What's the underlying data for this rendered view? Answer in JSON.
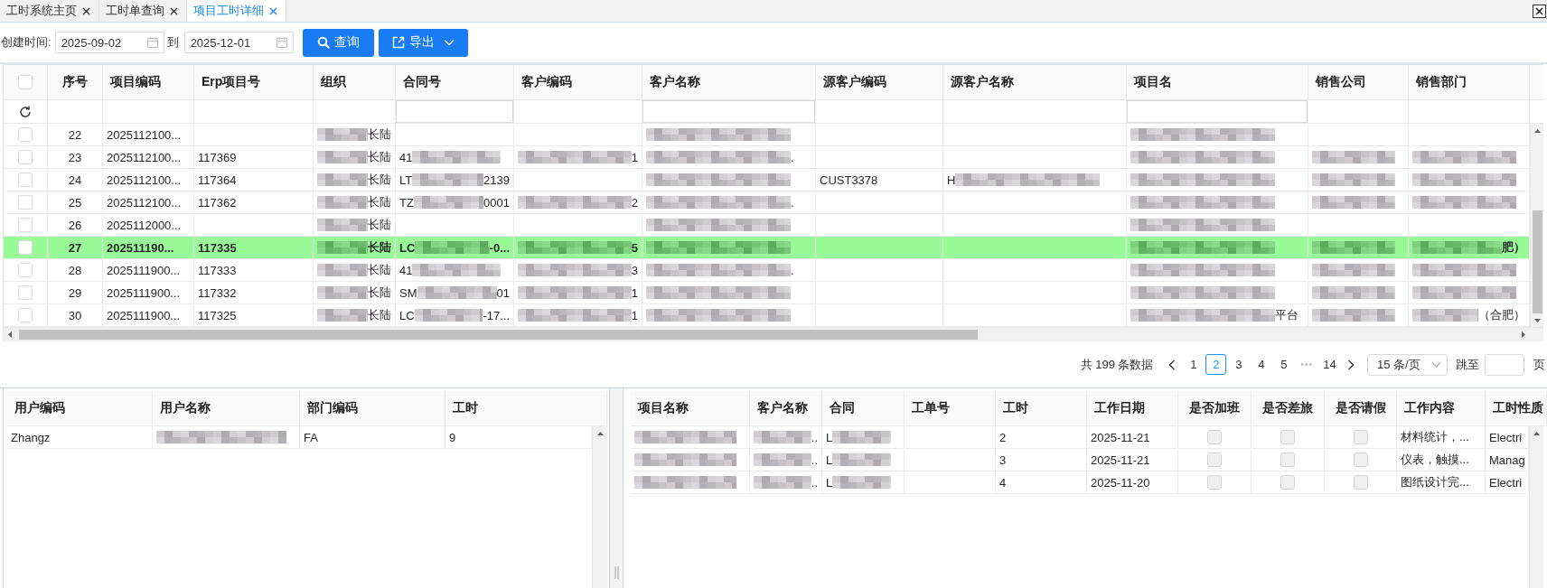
{
  "tabs": [
    {
      "label": "工时系统主页",
      "selected": false
    },
    {
      "label": "工时单查询",
      "selected": false
    },
    {
      "label": "项目工时详细",
      "selected": true
    }
  ],
  "toolbar": {
    "date_label": "创建时间:",
    "start_date": "2025-09-02",
    "range_separator": "到",
    "end_date": "2025-12-01",
    "buttons": [
      {
        "label": "查询",
        "kind": "search"
      },
      {
        "label": "导出",
        "kind": "export"
      }
    ]
  },
  "main_table": {
    "select_all": {
      "checked": false
    },
    "columns": [
      {
        "label": "序号",
        "filter": false
      },
      {
        "label": "项目编码",
        "filter": false
      },
      {
        "label": "Erp项目号",
        "filter": false
      },
      {
        "label": "组织",
        "filter": false
      },
      {
        "label": "合同号",
        "filter": true
      },
      {
        "label": "客户编码",
        "filter": false
      },
      {
        "label": "客户名称",
        "filter": true
      },
      {
        "label": "源客户编码",
        "filter": false
      },
      {
        "label": "源客户名称",
        "filter": false
      },
      {
        "label": "项目名",
        "filter": true
      },
      {
        "label": "销售公司",
        "filter": false
      },
      {
        "label": "销售部门",
        "filter": false
      }
    ],
    "rows": [
      {
        "checked": false,
        "selected": false,
        "cells": [
          "22",
          "2025112100...",
          null,
          {
            "blurred": true,
            "after": "长陆"
          },
          null,
          null,
          {
            "blurred": true
          },
          null,
          null,
          {
            "blurred": true
          },
          null,
          null
        ]
      },
      {
        "checked": false,
        "selected": false,
        "cells": [
          "23",
          "2025112100...",
          "117369",
          {
            "blurred": true,
            "after": "长陆"
          },
          {
            "before": "41",
            "blurred": true
          },
          {
            "blurred": true,
            "after": "1"
          },
          {
            "blurred": true,
            "after": "."
          },
          null,
          null,
          {
            "blurred": true
          },
          {
            "blurred": true
          },
          {
            "blurred": true
          }
        ]
      },
      {
        "checked": false,
        "selected": false,
        "cells": [
          "24",
          "2025112100...",
          "117364",
          {
            "blurred": true,
            "after": "长陆"
          },
          {
            "before": "LT",
            "blurred": true,
            "after": "2139"
          },
          null,
          {
            "blurred": true
          },
          "CUST3378",
          {
            "before": "H",
            "blurred": true
          },
          {
            "blurred": true
          },
          {
            "blurred": true
          },
          {
            "blurred": true
          }
        ]
      },
      {
        "checked": false,
        "selected": false,
        "cells": [
          "25",
          "2025112100...",
          "117362",
          {
            "blurred": true,
            "after": "长陆"
          },
          {
            "before": "TZ",
            "blurred": true,
            "after": "0001"
          },
          {
            "blurred": true,
            "after": "2"
          },
          {
            "blurred": true,
            "after": "."
          },
          null,
          null,
          {
            "blurred": true
          },
          {
            "blurred": true
          },
          {
            "blurred": true
          }
        ]
      },
      {
        "checked": false,
        "selected": false,
        "cells": [
          "26",
          "2025112000...",
          null,
          {
            "blurred": true,
            "after": "长陆"
          },
          null,
          null,
          {
            "blurred": true
          },
          null,
          null,
          {
            "blurred": true
          },
          null,
          null
        ]
      },
      {
        "checked": false,
        "selected": true,
        "cells": [
          "27",
          "202511190...",
          "117335",
          {
            "blurred": true,
            "after": "长陆"
          },
          {
            "before": "LC",
            "blurred": true,
            "after": "-0..."
          },
          {
            "blurred": true,
            "after": "5"
          },
          {
            "blurred": true
          },
          null,
          null,
          {
            "blurred": true
          },
          {
            "blurred": true
          },
          {
            "blurred": true,
            "after": "肥）"
          }
        ]
      },
      {
        "checked": false,
        "selected": false,
        "cells": [
          "28",
          "2025111900...",
          "117333",
          {
            "blurred": true,
            "after": "长陆"
          },
          {
            "before": "41",
            "blurred": true
          },
          {
            "blurred": true,
            "after": "3"
          },
          {
            "blurred": true,
            "after": "."
          },
          null,
          null,
          {
            "blurred": true
          },
          {
            "blurred": true
          },
          {
            "blurred": true
          }
        ]
      },
      {
        "checked": false,
        "selected": false,
        "cells": [
          "29",
          "2025111900...",
          "117332",
          {
            "blurred": true,
            "after": "长陆"
          },
          {
            "before": "SM",
            "blurred": true,
            "after": "01"
          },
          {
            "blurred": true,
            "after": "1"
          },
          {
            "blurred": true
          },
          null,
          null,
          {
            "blurred": true
          },
          {
            "blurred": true
          },
          {
            "blurred": true
          }
        ]
      },
      {
        "checked": false,
        "selected": false,
        "cells": [
          "30",
          "2025111900...",
          "117325",
          {
            "blurred": true,
            "after": "长陆"
          },
          {
            "before": "LC",
            "blurred": true,
            "after": "-17..."
          },
          {
            "blurred": true,
            "after": "1"
          },
          {
            "blurred": true
          },
          null,
          null,
          {
            "blurred": true,
            "after": "平台"
          },
          {
            "blurred": true
          },
          {
            "blurred": true,
            "after": "（合肥）"
          }
        ]
      }
    ]
  },
  "pagination": {
    "total": "共 199 条数据",
    "pages": [
      {
        "kind": "page",
        "label": "1",
        "selected": false
      },
      {
        "kind": "page",
        "label": "2",
        "selected": true
      },
      {
        "kind": "page",
        "label": "3",
        "selected": false
      },
      {
        "kind": "page",
        "label": "4",
        "selected": false
      },
      {
        "kind": "page",
        "label": "5",
        "selected": false
      },
      {
        "kind": "ellipsis",
        "label": "•••",
        "selected": false
      },
      {
        "kind": "page",
        "label": "14",
        "selected": false
      }
    ],
    "page_size": "15 条/页",
    "jump_label": "跳至",
    "page_unit": "页"
  },
  "user_table": {
    "columns": [
      "用户编码",
      "用户名称",
      "部门编码",
      "工时"
    ],
    "rows": [
      {
        "cells": [
          "Zhangz",
          {
            "blurred": true
          },
          "FA",
          "9"
        ]
      }
    ]
  },
  "detail_table": {
    "columns": [
      "项目名称",
      "客户名称",
      "合同",
      "工单号",
      "工时",
      "工作日期",
      "是否加班",
      "是否差旅",
      "是否请假",
      "工作内容",
      "工时性质"
    ],
    "rows": [
      {
        "cells": [
          {
            "blurred": true
          },
          {
            "blurred": true,
            "after": ".."
          },
          {
            "before": "L",
            "blurred": true
          },
          null,
          "2",
          "2025-11-21",
          {
            "checked": false,
            "disabled": true
          },
          {
            "checked": false,
            "disabled": true
          },
          {
            "checked": false,
            "disabled": true
          },
          "材料统计，...",
          "Electri"
        ]
      },
      {
        "cells": [
          {
            "blurred": true
          },
          {
            "blurred": true,
            "after": ".."
          },
          {
            "before": "L",
            "blurred": true
          },
          null,
          "3",
          "2025-11-21",
          {
            "checked": false,
            "disabled": true
          },
          {
            "checked": false,
            "disabled": true
          },
          {
            "checked": false,
            "disabled": true
          },
          "仪表，触摸...",
          "Manag"
        ]
      },
      {
        "cells": [
          {
            "blurred": true
          },
          {
            "blurred": true,
            "after": ".."
          },
          {
            "before": "L",
            "blurred": true
          },
          null,
          "4",
          "2025-11-20",
          {
            "checked": false,
            "disabled": true
          },
          {
            "checked": false,
            "disabled": true
          },
          {
            "checked": false,
            "disabled": true
          },
          "图纸设计完...",
          "Electri"
        ]
      }
    ]
  }
}
